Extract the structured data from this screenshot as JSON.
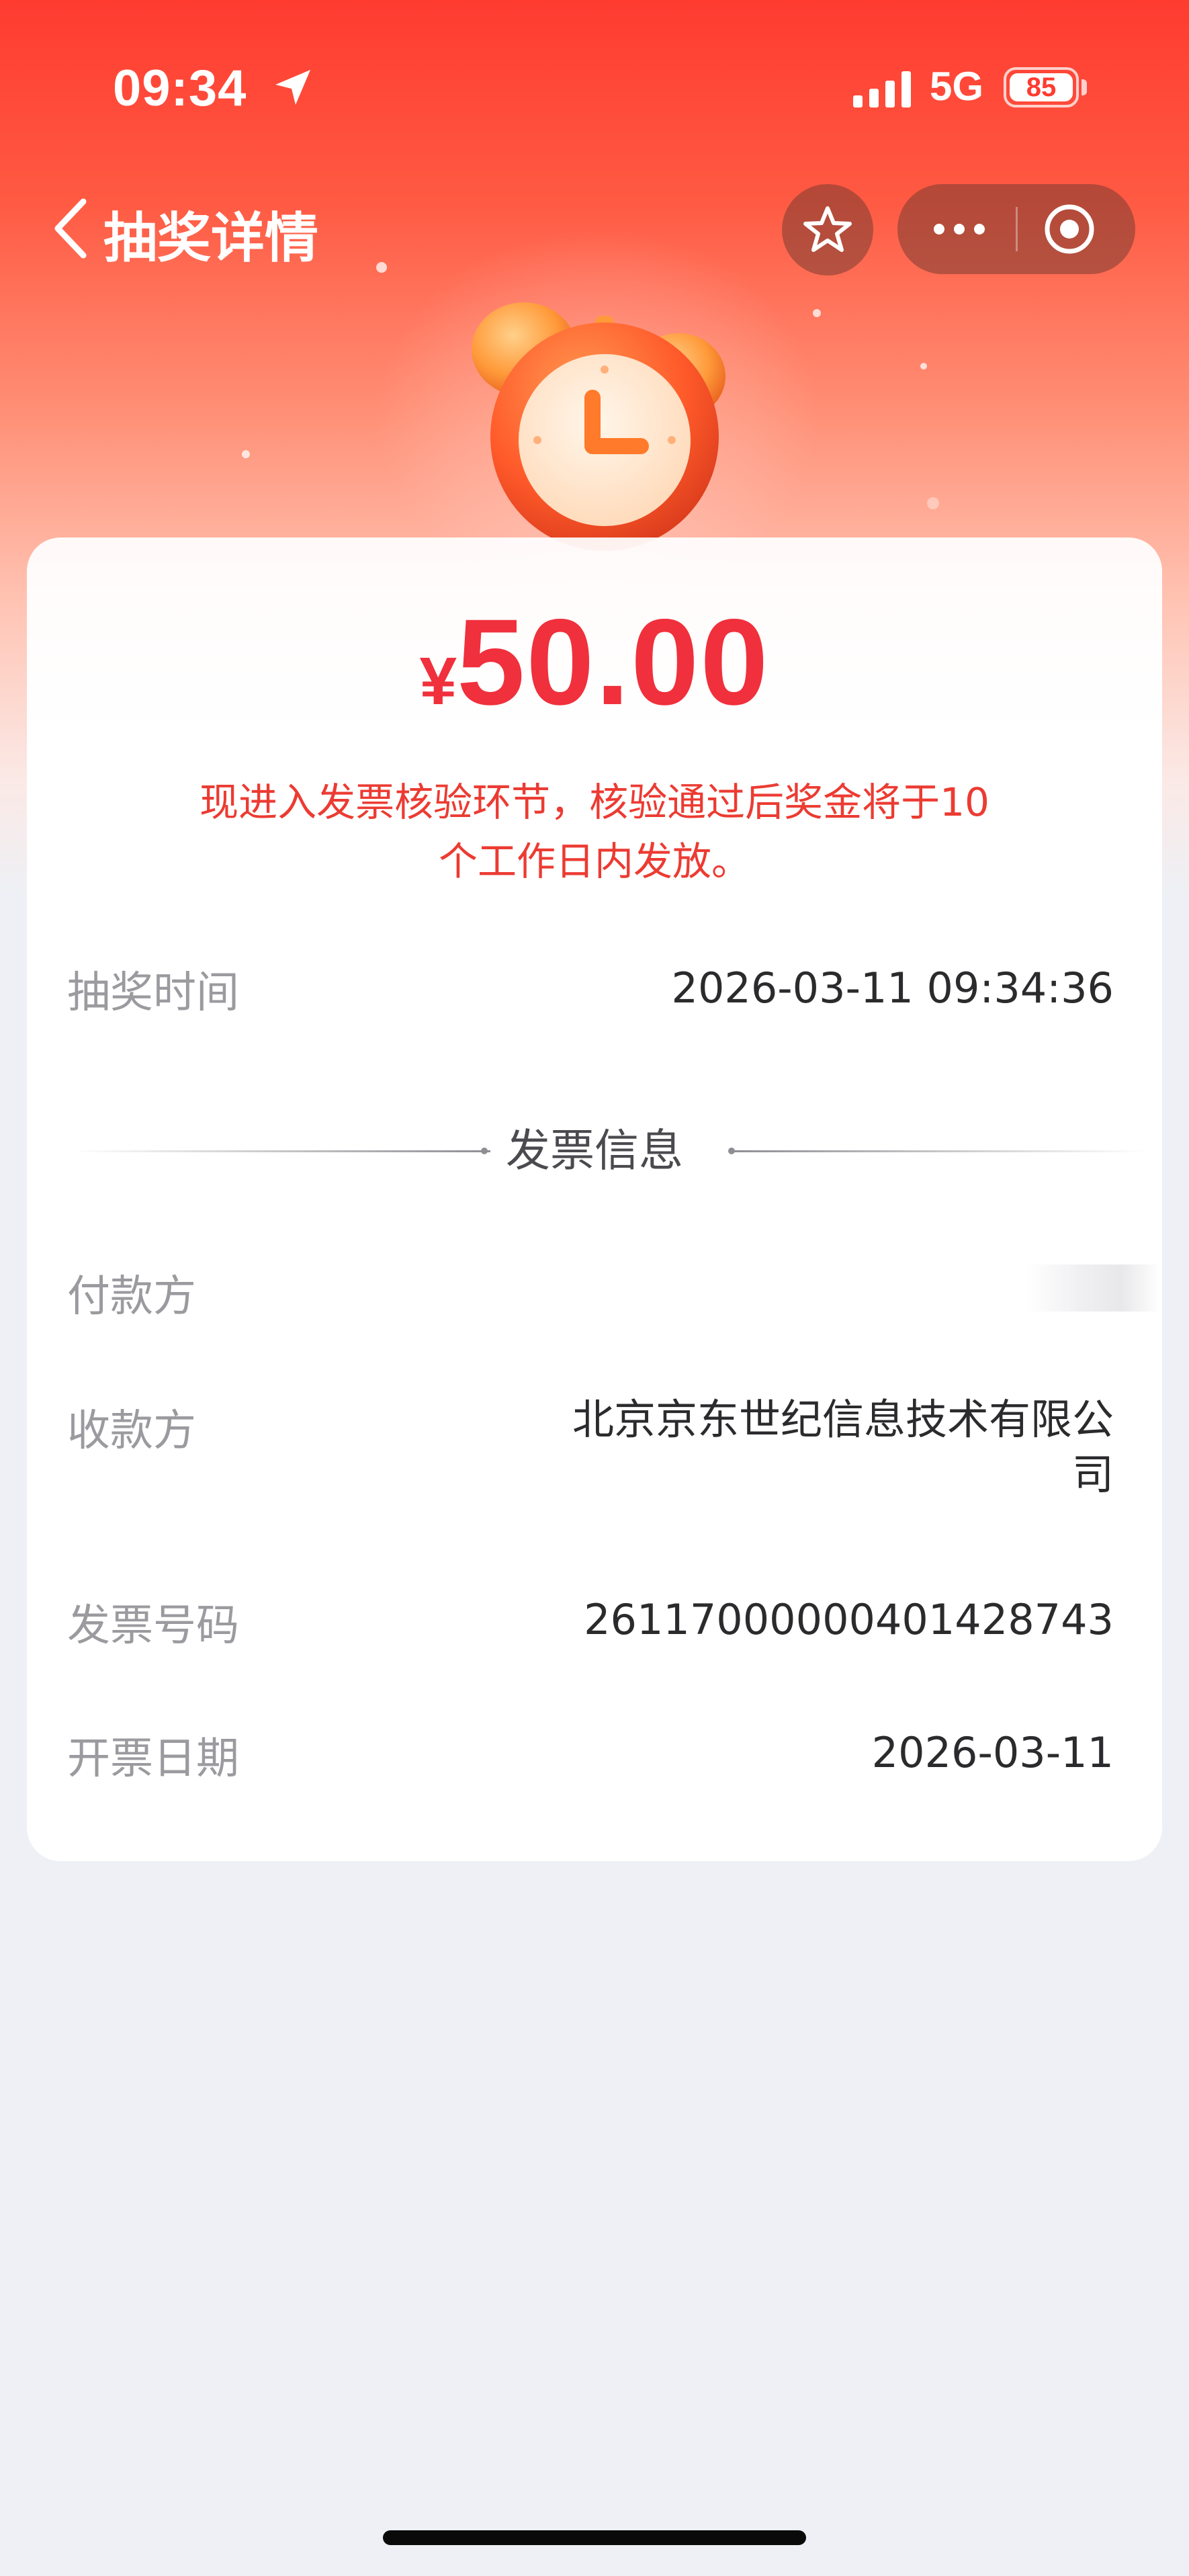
{
  "status_bar": {
    "time": "09:34",
    "network": "5G",
    "battery": "85",
    "icons": [
      "location-arrow-icon",
      "cellular-signal-icon",
      "battery-icon"
    ]
  },
  "nav": {
    "title": "抽奖详情",
    "back_icon": "chevron-left-icon",
    "favorite_icon": "star-outline-icon",
    "more_icon": "more-dots-icon",
    "close_icon": "target-circle-icon"
  },
  "illustration": {
    "icon": "alarm-clock-icon"
  },
  "prize": {
    "currency_symbol": "¥",
    "amount": "50.00",
    "notice_line1": "现进入发票核验环节，核验通过后奖金将于10",
    "notice_line2": "个工作日内发放。"
  },
  "draw_time": {
    "label": "抽奖时间",
    "value": "2026-03-11 09:34:36"
  },
  "invoice": {
    "section_title": "发票信息",
    "payer_label": "付款方",
    "payee_label": "收款方",
    "payee_value_line1": "北京京东世纪信息技术有限公",
    "payee_value_line2": "司",
    "invoice_no_label": "发票号码",
    "invoice_no_value": "26117000000401428743",
    "date_label": "开票日期",
    "date_value": "2026-03-11"
  },
  "colors": {
    "brand_red": "#ff3b30",
    "amount_red": "#f0303c",
    "page_bg": "#eef0f5"
  }
}
